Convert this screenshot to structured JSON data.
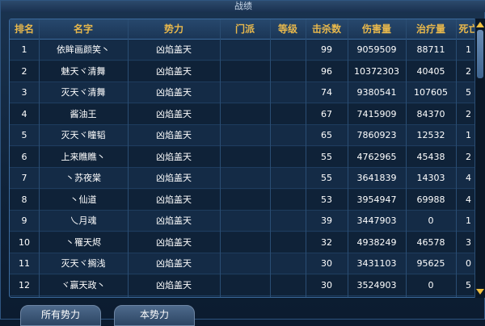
{
  "window": {
    "title": "战绩"
  },
  "table": {
    "columns": [
      "排名",
      "名字",
      "势力",
      "门派",
      "等级",
      "击杀数",
      "伤害量",
      "治疗量",
      "死亡"
    ],
    "rows": [
      [
        "1",
        "依眸画颜笑丶",
        "凶焰盖天",
        "",
        "",
        "99",
        "9059509",
        "88711",
        "1"
      ],
      [
        "2",
        "魅天ヾ清舞",
        "凶焰盖天",
        "",
        "",
        "96",
        "10372303",
        "40405",
        "2"
      ],
      [
        "3",
        "灭天ヾ清舞",
        "凶焰盖天",
        "",
        "",
        "74",
        "9380541",
        "107605",
        "5"
      ],
      [
        "4",
        "酱油王",
        "凶焰盖天",
        "",
        "",
        "67",
        "7415909",
        "84370",
        "2"
      ],
      [
        "5",
        "灭天ヾ瞳韬",
        "凶焰盖天",
        "",
        "",
        "65",
        "7860923",
        "12532",
        "1"
      ],
      [
        "6",
        "上来瞧瞧丶",
        "凶焰盖天",
        "",
        "",
        "55",
        "4762965",
        "45438",
        "2"
      ],
      [
        "7",
        "丶苏夜棠",
        "凶焰盖天",
        "",
        "",
        "55",
        "3641839",
        "14303",
        "4"
      ],
      [
        "8",
        "丶仙道",
        "凶焰盖天",
        "",
        "",
        "53",
        "3954947",
        "69988",
        "4"
      ],
      [
        "9",
        "乀月魂",
        "凶焰盖天",
        "",
        "",
        "39",
        "3447903",
        "0",
        "1"
      ],
      [
        "10",
        "丶罹天烬",
        "凶焰盖天",
        "",
        "",
        "32",
        "4938249",
        "46578",
        "3"
      ],
      [
        "11",
        "灭天ヾ搁浅",
        "凶焰盖天",
        "",
        "",
        "30",
        "3431103",
        "95625",
        "0"
      ],
      [
        "12",
        "ヾ赢天政丶",
        "凶焰盖天",
        "",
        "",
        "30",
        "3524903",
        "0",
        "5"
      ]
    ]
  },
  "tabs": [
    {
      "label": "所有势力"
    },
    {
      "label": "本势力"
    }
  ],
  "colors": {
    "header_text": "#e8b84c",
    "accent": "#3b6a9c"
  },
  "icons": {
    "scroll_up": "triangle-up-icon",
    "scroll_down": "triangle-down-icon"
  }
}
